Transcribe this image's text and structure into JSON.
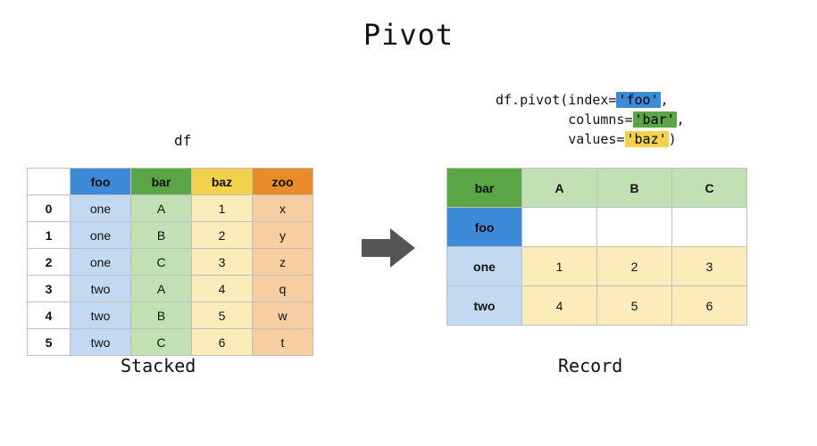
{
  "title": "Pivot",
  "df_label": "df",
  "code": {
    "line1_pre": "df.pivot(index=",
    "line1_hl": "'foo'",
    "line1_post": ",",
    "line2_pre": "         columns=",
    "line2_hl": "'bar'",
    "line2_post": ",",
    "line3_pre": "         values=",
    "line3_hl": "'baz'",
    "line3_post": ")"
  },
  "stacked": {
    "headers": {
      "foo": "foo",
      "bar": "bar",
      "baz": "baz",
      "zoo": "zoo"
    },
    "index": [
      "0",
      "1",
      "2",
      "3",
      "4",
      "5"
    ],
    "foo": [
      "one",
      "one",
      "one",
      "two",
      "two",
      "two"
    ],
    "bar": [
      "A",
      "B",
      "C",
      "A",
      "B",
      "C"
    ],
    "baz": [
      "1",
      "2",
      "3",
      "4",
      "5",
      "6"
    ],
    "zoo": [
      "x",
      "y",
      "z",
      "q",
      "w",
      "t"
    ],
    "caption": "Stacked"
  },
  "record": {
    "corner_bar": "bar",
    "cols": [
      "A",
      "B",
      "C"
    ],
    "corner_foo": "foo",
    "index": [
      "one",
      "two"
    ],
    "values": [
      [
        "1",
        "2",
        "3"
      ],
      [
        "4",
        "5",
        "6"
      ]
    ],
    "caption": "Record"
  }
}
